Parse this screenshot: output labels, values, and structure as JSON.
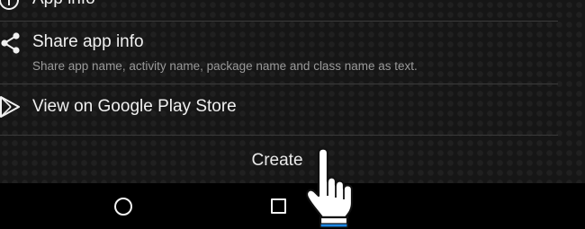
{
  "menu": {
    "items": [
      {
        "title": "App info",
        "icon": "info-icon"
      },
      {
        "title": "Share app info",
        "subtitle": "Share app name, activity name, package name and class name as text.",
        "icon": "share-icon"
      },
      {
        "title": "View on Google Play Store",
        "icon": "play-store-icon"
      }
    ]
  },
  "action": {
    "create_label": "Create"
  },
  "navigation": {
    "home_icon": "home-circle-icon",
    "recents_icon": "recents-square-icon"
  },
  "overlay": {
    "pointer_icon": "hand-pointer-icon"
  },
  "colors": {
    "background": "#121212",
    "text": "#f0f0f0",
    "subtext": "#9a9a9a",
    "divider": "#3a3a3a",
    "nav_bar": "#000000",
    "cuff_accent": "#1e88e5"
  }
}
